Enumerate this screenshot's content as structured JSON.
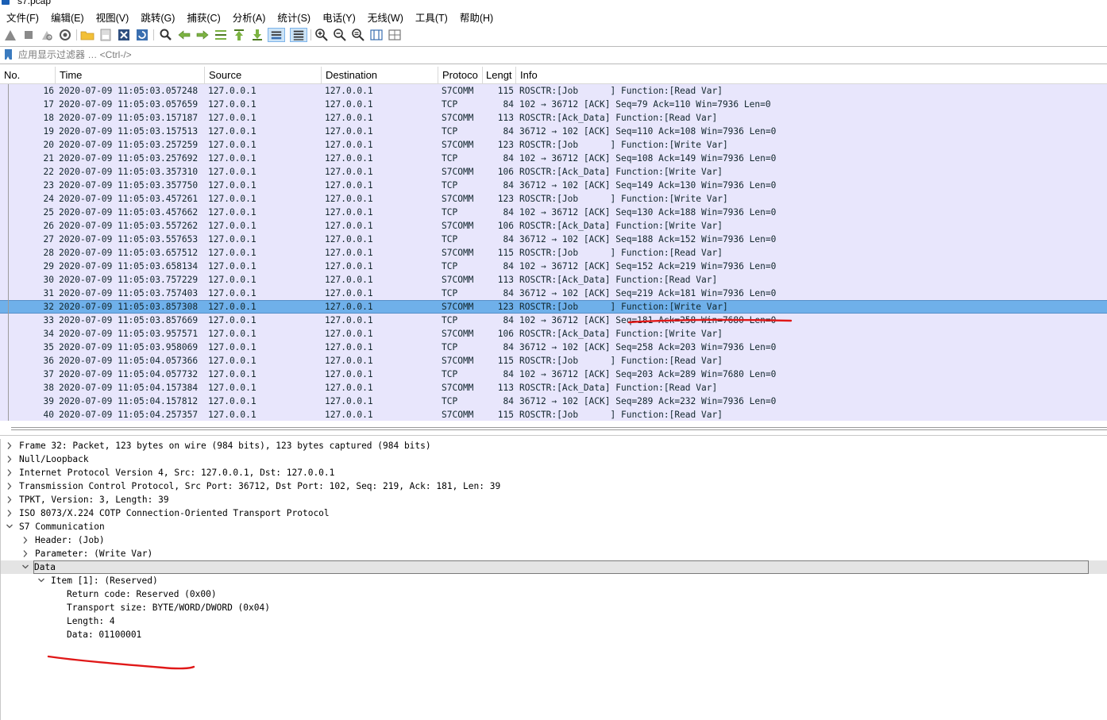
{
  "window": {
    "title": "s7.pcap"
  },
  "menu": [
    "文件(F)",
    "编辑(E)",
    "视图(V)",
    "跳转(G)",
    "捕获(C)",
    "分析(A)",
    "统计(S)",
    "电话(Y)",
    "无线(W)",
    "工具(T)",
    "帮助(H)"
  ],
  "toolbar": {
    "icons": [
      "shark-fin-start-icon",
      "stop-icon",
      "restart-icon",
      "capture-options-icon",
      "open-folder-icon",
      "save-file-icon",
      "close-file-icon",
      "reload-icon",
      "find-packet-icon",
      "go-back-icon",
      "go-forward-icon",
      "go-to-packet-icon",
      "go-first-icon",
      "go-last-icon",
      "autoscroll-icon",
      "colorize-icon",
      "zoom-in-icon",
      "zoom-out-icon",
      "zoom-normal-icon",
      "resize-columns-icon",
      "layout-icon"
    ]
  },
  "filter": {
    "placeholder": "应用显示过滤器 … <Ctrl-/>"
  },
  "packet_list": {
    "columns": [
      "No.",
      "Time",
      "Source",
      "Destination",
      "Protoco",
      "Lengt",
      "Info"
    ],
    "selected_no": "32",
    "rows": [
      {
        "no": "16",
        "time": "2020-07-09 11:05:03.057248",
        "src": "127.0.0.1",
        "dst": "127.0.0.1",
        "proto": "S7COMM",
        "len": "115",
        "info": "ROSCTR:[Job      ] Function:[Read Var]"
      },
      {
        "no": "17",
        "time": "2020-07-09 11:05:03.057659",
        "src": "127.0.0.1",
        "dst": "127.0.0.1",
        "proto": "TCP",
        "len": "84",
        "info": "102 → 36712 [ACK] Seq=79 Ack=110 Win=7936 Len=0"
      },
      {
        "no": "18",
        "time": "2020-07-09 11:05:03.157187",
        "src": "127.0.0.1",
        "dst": "127.0.0.1",
        "proto": "S7COMM",
        "len": "113",
        "info": "ROSCTR:[Ack_Data] Function:[Read Var]"
      },
      {
        "no": "19",
        "time": "2020-07-09 11:05:03.157513",
        "src": "127.0.0.1",
        "dst": "127.0.0.1",
        "proto": "TCP",
        "len": "84",
        "info": "36712 → 102 [ACK] Seq=110 Ack=108 Win=7936 Len=0"
      },
      {
        "no": "20",
        "time": "2020-07-09 11:05:03.257259",
        "src": "127.0.0.1",
        "dst": "127.0.0.1",
        "proto": "S7COMM",
        "len": "123",
        "info": "ROSCTR:[Job      ] Function:[Write Var]"
      },
      {
        "no": "21",
        "time": "2020-07-09 11:05:03.257692",
        "src": "127.0.0.1",
        "dst": "127.0.0.1",
        "proto": "TCP",
        "len": "84",
        "info": "102 → 36712 [ACK] Seq=108 Ack=149 Win=7936 Len=0"
      },
      {
        "no": "22",
        "time": "2020-07-09 11:05:03.357310",
        "src": "127.0.0.1",
        "dst": "127.0.0.1",
        "proto": "S7COMM",
        "len": "106",
        "info": "ROSCTR:[Ack_Data] Function:[Write Var]"
      },
      {
        "no": "23",
        "time": "2020-07-09 11:05:03.357750",
        "src": "127.0.0.1",
        "dst": "127.0.0.1",
        "proto": "TCP",
        "len": "84",
        "info": "36712 → 102 [ACK] Seq=149 Ack=130 Win=7936 Len=0"
      },
      {
        "no": "24",
        "time": "2020-07-09 11:05:03.457261",
        "src": "127.0.0.1",
        "dst": "127.0.0.1",
        "proto": "S7COMM",
        "len": "123",
        "info": "ROSCTR:[Job      ] Function:[Write Var]"
      },
      {
        "no": "25",
        "time": "2020-07-09 11:05:03.457662",
        "src": "127.0.0.1",
        "dst": "127.0.0.1",
        "proto": "TCP",
        "len": "84",
        "info": "102 → 36712 [ACK] Seq=130 Ack=188 Win=7936 Len=0"
      },
      {
        "no": "26",
        "time": "2020-07-09 11:05:03.557262",
        "src": "127.0.0.1",
        "dst": "127.0.0.1",
        "proto": "S7COMM",
        "len": "106",
        "info": "ROSCTR:[Ack_Data] Function:[Write Var]"
      },
      {
        "no": "27",
        "time": "2020-07-09 11:05:03.557653",
        "src": "127.0.0.1",
        "dst": "127.0.0.1",
        "proto": "TCP",
        "len": "84",
        "info": "36712 → 102 [ACK] Seq=188 Ack=152 Win=7936 Len=0"
      },
      {
        "no": "28",
        "time": "2020-07-09 11:05:03.657512",
        "src": "127.0.0.1",
        "dst": "127.0.0.1",
        "proto": "S7COMM",
        "len": "115",
        "info": "ROSCTR:[Job      ] Function:[Read Var]"
      },
      {
        "no": "29",
        "time": "2020-07-09 11:05:03.658134",
        "src": "127.0.0.1",
        "dst": "127.0.0.1",
        "proto": "TCP",
        "len": "84",
        "info": "102 → 36712 [ACK] Seq=152 Ack=219 Win=7936 Len=0"
      },
      {
        "no": "30",
        "time": "2020-07-09 11:05:03.757229",
        "src": "127.0.0.1",
        "dst": "127.0.0.1",
        "proto": "S7COMM",
        "len": "113",
        "info": "ROSCTR:[Ack_Data] Function:[Read Var]"
      },
      {
        "no": "31",
        "time": "2020-07-09 11:05:03.757403",
        "src": "127.0.0.1",
        "dst": "127.0.0.1",
        "proto": "TCP",
        "len": "84",
        "info": "36712 → 102 [ACK] Seq=219 Ack=181 Win=7936 Len=0"
      },
      {
        "no": "32",
        "time": "2020-07-09 11:05:03.857308",
        "src": "127.0.0.1",
        "dst": "127.0.0.1",
        "proto": "S7COMM",
        "len": "123",
        "info": "ROSCTR:[Job      ] Function:[Write Var]"
      },
      {
        "no": "33",
        "time": "2020-07-09 11:05:03.857669",
        "src": "127.0.0.1",
        "dst": "127.0.0.1",
        "proto": "TCP",
        "len": "84",
        "info": "102 → 36712 [ACK] Seq=181 Ack=258 Win=7680 Len=0"
      },
      {
        "no": "34",
        "time": "2020-07-09 11:05:03.957571",
        "src": "127.0.0.1",
        "dst": "127.0.0.1",
        "proto": "S7COMM",
        "len": "106",
        "info": "ROSCTR:[Ack_Data] Function:[Write Var]"
      },
      {
        "no": "35",
        "time": "2020-07-09 11:05:03.958069",
        "src": "127.0.0.1",
        "dst": "127.0.0.1",
        "proto": "TCP",
        "len": "84",
        "info": "36712 → 102 [ACK] Seq=258 Ack=203 Win=7936 Len=0"
      },
      {
        "no": "36",
        "time": "2020-07-09 11:05:04.057366",
        "src": "127.0.0.1",
        "dst": "127.0.0.1",
        "proto": "S7COMM",
        "len": "115",
        "info": "ROSCTR:[Job      ] Function:[Read Var]"
      },
      {
        "no": "37",
        "time": "2020-07-09 11:05:04.057732",
        "src": "127.0.0.1",
        "dst": "127.0.0.1",
        "proto": "TCP",
        "len": "84",
        "info": "102 → 36712 [ACK] Seq=203 Ack=289 Win=7680 Len=0"
      },
      {
        "no": "38",
        "time": "2020-07-09 11:05:04.157384",
        "src": "127.0.0.1",
        "dst": "127.0.0.1",
        "proto": "S7COMM",
        "len": "113",
        "info": "ROSCTR:[Ack_Data] Function:[Read Var]"
      },
      {
        "no": "39",
        "time": "2020-07-09 11:05:04.157812",
        "src": "127.0.0.1",
        "dst": "127.0.0.1",
        "proto": "TCP",
        "len": "84",
        "info": "36712 → 102 [ACK] Seq=289 Ack=232 Win=7936 Len=0"
      },
      {
        "no": "40",
        "time": "2020-07-09 11:05:04.257357",
        "src": "127.0.0.1",
        "dst": "127.0.0.1",
        "proto": "S7COMM",
        "len": "115",
        "info": "ROSCTR:[Job      ] Function:[Read Var]"
      }
    ]
  },
  "details": [
    {
      "text": "Frame 32: Packet, 123 bytes on wire (984 bits), 123 bytes captured (984 bits)",
      "state": "collapsed"
    },
    {
      "text": "Null/Loopback",
      "state": "collapsed"
    },
    {
      "text": "Internet Protocol Version 4, Src: 127.0.0.1, Dst: 127.0.0.1",
      "state": "collapsed"
    },
    {
      "text": "Transmission Control Protocol, Src Port: 36712, Dst Port: 102, Seq: 219, Ack: 181, Len: 39",
      "state": "collapsed"
    },
    {
      "text": "TPKT, Version: 3, Length: 39",
      "state": "collapsed"
    },
    {
      "text": "ISO 8073/X.224 COTP Connection-Oriented Transport Protocol",
      "state": "collapsed"
    },
    {
      "text": "S7 Communication",
      "state": "expanded"
    },
    {
      "text": "Header: (Job)",
      "state": "collapsed"
    },
    {
      "text": "Parameter: (Write Var)",
      "state": "collapsed"
    },
    {
      "text": "Data",
      "state": "expanded",
      "highlighted": true
    },
    {
      "text": "Item [1]: (Reserved)",
      "state": "expanded"
    },
    {
      "text": "Return code: Reserved (0x00)",
      "state": "leaf"
    },
    {
      "text": "Transport size: BYTE/WORD/DWORD (0x04)",
      "state": "leaf"
    },
    {
      "text": "Length: 4",
      "state": "leaf"
    },
    {
      "text": "Data: 01100001",
      "state": "leaf"
    }
  ],
  "colors": {
    "row_bg": "#e8e6fc",
    "selected_row_bg": "#6fb0ea",
    "annotation": "#e01818"
  }
}
